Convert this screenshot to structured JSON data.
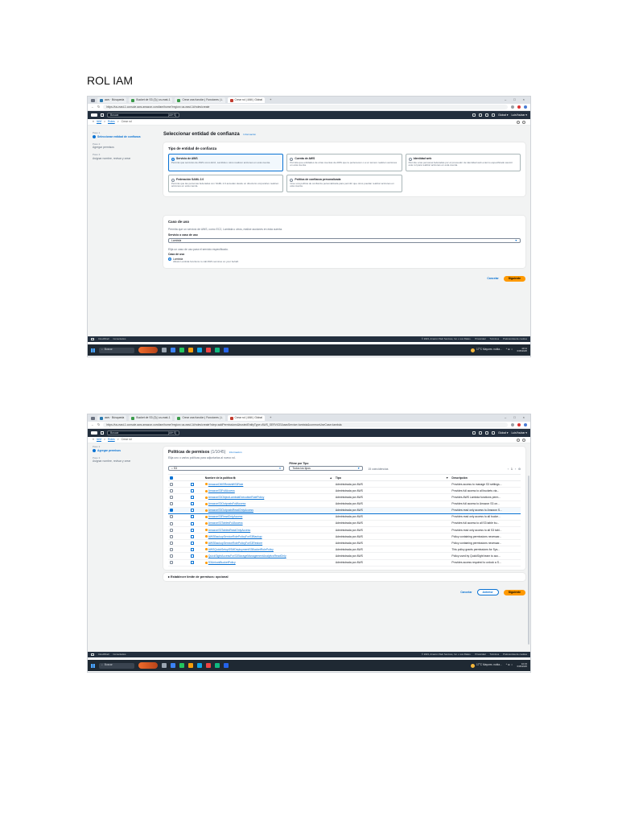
{
  "document": {
    "title": "ROL IAM"
  },
  "colors": {
    "aws_header": "#232f3e",
    "link": "#0972d3",
    "primary_button": "#ff9900",
    "console_bg": "#f2f3f3"
  },
  "browser": {
    "tabs": [
      "aws · Búsqueda",
      "Bucket de S3 (3) | us-east-1",
      "Crear una función | Funciones | L",
      "Crear rol | IAM | Global"
    ],
    "new_tab": "+",
    "url1": "https://us-east-1.console.aws.amazon.com/iam/home?region=us-east-1#/roles/create",
    "url2": "https://us-east-1.console.aws.amazon.com/iam/home?region=us-east-1#/roles/create?step=addPermissions&trustedEntityType=AWS_SERVICE&awsService=lambda&commonUseCase=lambda"
  },
  "aws": {
    "search_placeholder": "Buscar",
    "search_shortcut": "[Alt+S]",
    "region": "Global ▾",
    "account": "LuisYoubar ▾",
    "breadcrumb": {
      "root": "IAM",
      "sep": ">",
      "roles": "Roles",
      "current": "Crear rol"
    },
    "footer": {
      "cloudshell": "CloudShell",
      "comments": "Comentarios",
      "copyright": "© 2023, Amazon Web Services, Inc. o sus filiales.",
      "privacy": "Privacidad",
      "terms": "Términos",
      "cookies": "Preferencias de cookies"
    }
  },
  "screen1": {
    "steps": [
      {
        "num": "Paso 1",
        "label": "Seleccionar entidad de confianza"
      },
      {
        "num": "Paso 2",
        "label": "Agregar permisos"
      },
      {
        "num": "Paso 3",
        "label": "Asignar nombre, revisar y crear"
      }
    ],
    "title": "Seleccionar entidad de confianza",
    "info": "Información",
    "entity_card": {
      "title": "Tipo de entidad de confianza",
      "tiles": [
        {
          "title": "Servicio de AWS",
          "desc": "Permita que servicios de AWS como EC2, Lambda u otros realicen acciones en esta cuenta."
        },
        {
          "title": "Cuenta de AWS",
          "desc": "Permita que entidades de otras cuentas de AWS que le pertenecen o a un tercero realicen acciones en esta cuenta."
        },
        {
          "title": "Identidad web",
          "desc": "Permite a las personas federadas por el proveedor de identidad web externo especificado asumir este rol para realizar acciones en esta cuenta."
        },
        {
          "title": "Federación SAML 2.0",
          "desc": "Permita que las personas federadas con SAML 2.0 accedan desde un directorio corporativo realicen acciones en esta cuenta."
        },
        {
          "title": "Política de confianza personalizada",
          "desc": "Cree una política de confianza personalizada para permitir que otros puedan realizar acciones en esta cuenta."
        }
      ]
    },
    "usecase_card": {
      "title": "Caso de uso",
      "desc": "Permita que un servicio de AWS, como EC2, Lambda u otros, realice acciones en esta cuenta.",
      "service_label": "Servicio o caso de uso",
      "service_value": "Lambda",
      "choose_text": "Elija un caso de uso para el servicio especificado.",
      "usecase_label": "Caso de uso",
      "option": "Lambda",
      "option_desc": "Allows Lambda functions to call AWS services on your behalf."
    },
    "cancel": "Cancelar",
    "next": "Siguiente"
  },
  "screen2": {
    "steps": [
      {
        "num": "Paso 2",
        "label": "Agregar permisos"
      },
      {
        "num": "Paso 3",
        "label": "Asignar nombre, revisar y crear"
      }
    ],
    "title": "Políticas de permisos",
    "count": "(1/1045)",
    "info": "Información",
    "subtitle": "Elija uno o varios políticas para adjuntarlas al nuevo rol.",
    "search_value": "S3",
    "filter_label": "Filtrar por Tipo",
    "filter_value": "Todos los tipos",
    "matches": "15 coincidencias",
    "page": "1",
    "columns": {
      "name": "Nombre de la política",
      "type": "Tipo",
      "desc": "Descripción"
    },
    "rows": [
      {
        "name": "AmazonDMSRedshiftS3Role",
        "type": "Administrada por AWS",
        "desc": "Provides access to manage S3 settings..."
      },
      {
        "name": "AmazonS3FullAccess",
        "type": "Administrada por AWS",
        "desc": "Provides full access to all buckets via..."
      },
      {
        "name": "AmazonS3ObjectLambdaExecutionRolePolicy",
        "type": "Administrada por AWS",
        "desc": "Provides AWS Lambda functions perm..."
      },
      {
        "name": "AmazonS3OutpostsFullAccess",
        "type": "Administrada por AWS",
        "desc": "Provides full access to Amazon S3 on..."
      },
      {
        "name": "AmazonS3OutpostsReadOnlyAccess",
        "type": "Administrada por AWS",
        "desc": "Provides read only access to Amazon S..."
      },
      {
        "name": "AmazonS3ReadOnlyAccess",
        "type": "Administrada por AWS",
        "desc": "Provides read only access to all bucke..."
      },
      {
        "name": "AmazonS3TablesFullAccess",
        "type": "Administrada por AWS",
        "desc": "Provides full access to all S3 table bu..."
      },
      {
        "name": "AmazonS3TablesReadOnlyAccess",
        "type": "Administrada por AWS",
        "desc": "Provides read only access to all S3 tabl..."
      },
      {
        "name": "AWSBackupServiceRolePolicyForS3Backup",
        "type": "Administrada por AWS",
        "desc": "Policy containing permissions necessar..."
      },
      {
        "name": "AWSBackupServiceRolePolicyForS3Restore",
        "type": "Administrada por AWS",
        "desc": "Policy containing permissions necessar..."
      },
      {
        "name": "AWSQuickSetupSSMDeploymentS3BucketRolePolicy",
        "type": "Administrada por AWS",
        "desc": "This policy grants permissions for Sys..."
      },
      {
        "name": "QuickSightAccessForS3StorageManagementAnalyticsReadOnly",
        "type": "Administrada por AWS",
        "desc": "Policy used by QuickSight team to acc..."
      },
      {
        "name": "S3UnlockBucketPolicy",
        "type": "Administrada por AWS",
        "desc": "Provides access required to unlock a S..."
      }
    ],
    "selected_index": 4,
    "boundary": "Establecer límite de permisos: opcional",
    "cancel": "Cancelar",
    "previous": "Anterior",
    "next": "Siguiente"
  },
  "taskbar": {
    "search": "Buscar",
    "weather": "17°C Mayorm. nubla...",
    "time1": "10:11",
    "date1": "6/05/2025",
    "time2": "10:15",
    "date2": "6/05/2025"
  }
}
